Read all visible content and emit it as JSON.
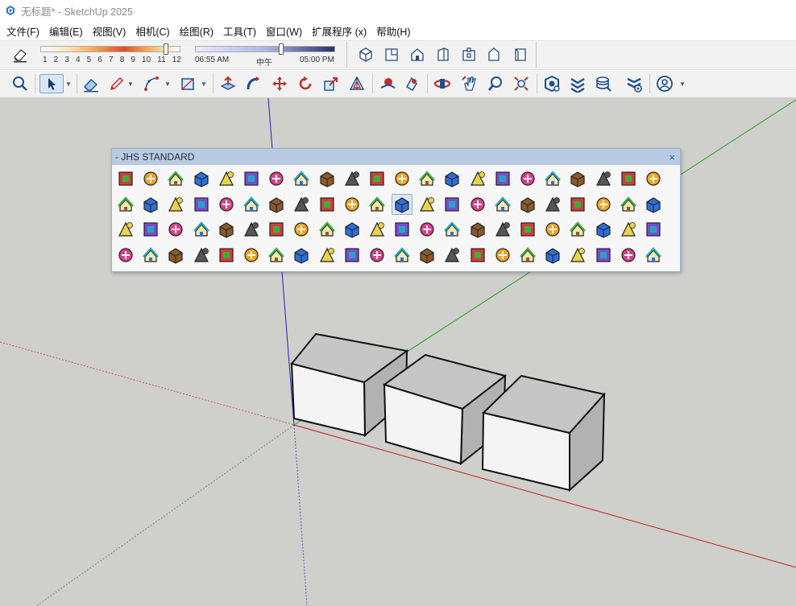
{
  "window": {
    "title": "无标题* - SketchUp 2025"
  },
  "menu": [
    "文件(F)",
    "编辑(E)",
    "视图(V)",
    "相机(C)",
    "绘图(R)",
    "工具(T)",
    "窗口(W)",
    "扩展程序 (x)",
    "帮助(H)"
  ],
  "shadows": {
    "months": [
      "1",
      "2",
      "3",
      "4",
      "5",
      "6",
      "7",
      "8",
      "9",
      "10",
      "11",
      "12"
    ],
    "month_value": 11,
    "time_start": "06:55 AM",
    "time_mid": "中午",
    "time_end": "05:00 PM",
    "time_value": 0.62
  },
  "views_toolbar": [
    "iso-view-icon",
    "top-view-icon",
    "front-view-icon",
    "right-view-icon",
    "back-view-icon",
    "left-view-icon",
    "bottom-view-icon"
  ],
  "toolbar": [
    "search-icon",
    "select-icon",
    "eraser-icon",
    "pencil-icon",
    "arc-icon",
    "rectangle-icon",
    "push-pull-icon",
    "follow-me-icon",
    "move-icon",
    "rotate-icon",
    "scale-icon",
    "offset-icon",
    "position-camera-icon",
    "look-around-icon",
    "orbit-icon",
    "pan-icon",
    "zoom-icon",
    "zoom-extents-icon",
    "trimble-connect-icon",
    "layers-icon",
    "stack-icon",
    "extension-warehouse-icon",
    "account-icon"
  ],
  "jhs": {
    "title": "- JHS STANDARD",
    "close": "×",
    "colors": [
      "#d93a3a",
      "#f2a321",
      "#3cae3c",
      "#2e6fd6",
      "#e8d34a",
      "#7c4ad6",
      "#dd3e8c",
      "#27a6b8",
      "#8b5a2b",
      "#555555"
    ],
    "icon_count": 88
  },
  "scene": {
    "boxes": 3
  }
}
